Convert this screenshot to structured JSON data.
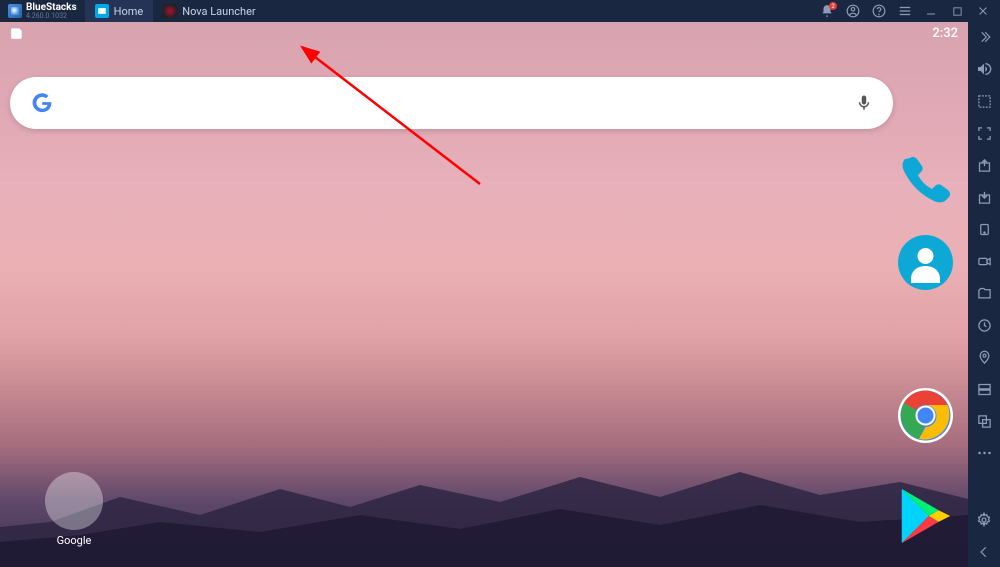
{
  "app": {
    "name": "BlueStacks",
    "version": "4.260.0.1032"
  },
  "tabs": [
    {
      "label": "Home",
      "icon": "home"
    },
    {
      "label": "Nova Launcher",
      "icon": "nova"
    }
  ],
  "topbar_icons": {
    "notification_count": "2"
  },
  "statusbar": {
    "time": "2:32"
  },
  "folder": {
    "label": "Google"
  },
  "sidebar_icons": [
    "chevron-right",
    "volume",
    "capture-region",
    "fullscreen",
    "keymap-export",
    "keymap-import",
    "lock-rotation",
    "camera",
    "folder",
    "clock",
    "location",
    "macro",
    "multi-instance",
    "more"
  ]
}
